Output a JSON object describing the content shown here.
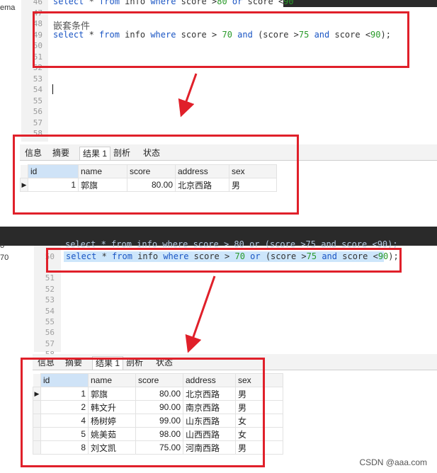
{
  "top_editor": {
    "left_fragment": "ema",
    "lines": [
      {
        "no": "46"
      },
      {
        "no": "47"
      },
      {
        "no": "48"
      },
      {
        "no": "49"
      },
      {
        "no": "50"
      },
      {
        "no": "51"
      },
      {
        "no": "52"
      },
      {
        "no": "53"
      },
      {
        "no": "54"
      },
      {
        "no": "55"
      },
      {
        "no": "56"
      },
      {
        "no": "57"
      },
      {
        "no": "58"
      }
    ],
    "line46": {
      "a": "select",
      "b": " * ",
      "c": "from",
      "d": " info ",
      "e": "where",
      "f": " score >",
      "g": "80",
      "h": " or",
      "i": " score <",
      "j": "90"
    },
    "comment": "嵌套条件",
    "query": {
      "a": "select",
      "b": " * ",
      "c": "from",
      "d": " info ",
      "e": "where",
      "f": " score > ",
      "g": "70",
      "h": " ",
      "i": "and",
      "j": " (score >",
      "k": "75",
      "l": " ",
      "m": "and",
      "n": " score <",
      "o": "90",
      "p": ");"
    }
  },
  "top_results": {
    "tabs": [
      "信息",
      "摘要",
      "结果 1",
      "剖析",
      "状态"
    ],
    "active_tab": "结果 1",
    "columns": [
      "id",
      "name",
      "score",
      "address",
      "sex"
    ],
    "rows": [
      {
        "id": "1",
        "name": "郭旗",
        "score": "80.00",
        "address": "北京西路",
        "sex": "男"
      }
    ]
  },
  "bottom_editor": {
    "left_fragments": [
      "o",
      "70"
    ],
    "faded_line": "select * from info where score > 80 or (score >75 and score <90);",
    "line_numbers": [
      "50",
      "51",
      "52",
      "53",
      "54",
      "55",
      "56",
      "57",
      "58"
    ],
    "query": {
      "a": "select",
      "b": " * ",
      "c": "from",
      "d": " info ",
      "e": "where",
      "f": " score > ",
      "g": "70",
      "h": " ",
      "i": "or",
      "j": " (score >",
      "k": "75",
      "l": " ",
      "m": "and",
      "n": " score <",
      "o": "90",
      "p": ");"
    }
  },
  "bottom_results": {
    "tabs": [
      "信息",
      "摘要",
      "结果 1",
      "剖析",
      "状态"
    ],
    "active_tab": "结果 1",
    "columns": [
      "id",
      "name",
      "score",
      "address",
      "sex"
    ],
    "rows": [
      {
        "id": "1",
        "name": "郭旗",
        "score": "80.00",
        "address": "北京西路",
        "sex": "男"
      },
      {
        "id": "2",
        "name": "韩文升",
        "score": "90.00",
        "address": "南京西路",
        "sex": "男"
      },
      {
        "id": "4",
        "name": "杨树婷",
        "score": "99.00",
        "address": "山东西路",
        "sex": "女"
      },
      {
        "id": "5",
        "name": "姚美茹",
        "score": "98.00",
        "address": "山西西路",
        "sex": "女"
      },
      {
        "id": "8",
        "name": "刘文凯",
        "score": "75.00",
        "address": "河南西路",
        "sex": "男"
      }
    ]
  },
  "watermark": "CSDN @aaa.com",
  "colors": {
    "annotation_red": "#e0202a",
    "keyword_blue": "#1a55c4",
    "number_green": "#2a9a2a",
    "selection": "#cde6fb"
  }
}
